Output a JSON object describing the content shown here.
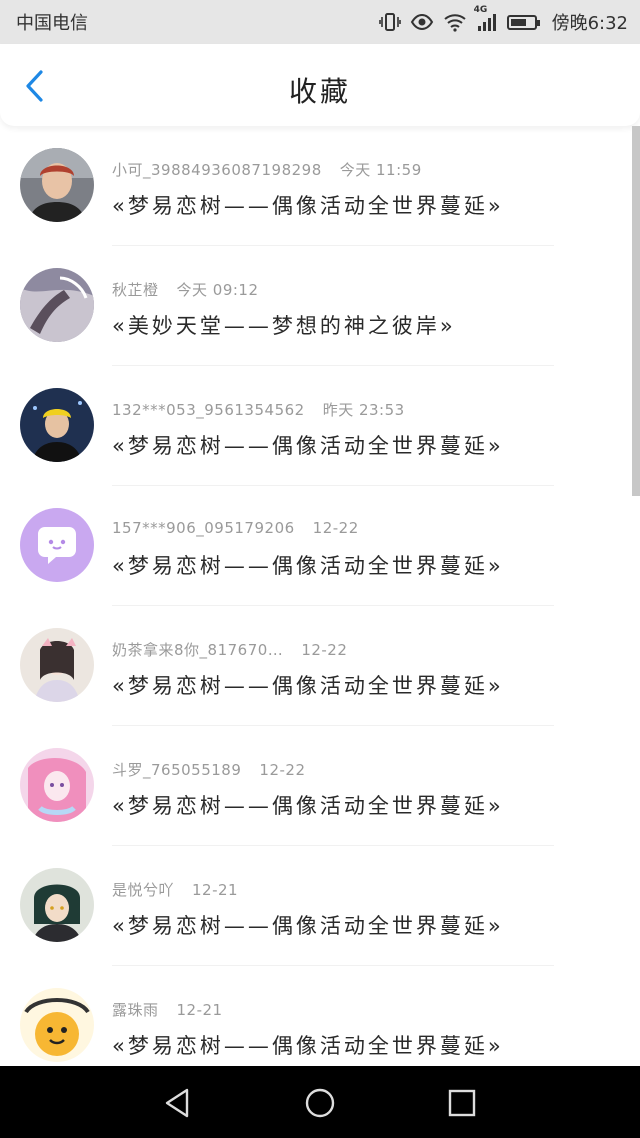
{
  "status_bar": {
    "carrier": "中国电信",
    "network": "4G",
    "time": "傍晚6:32"
  },
  "header": {
    "title": "收藏"
  },
  "items": [
    {
      "user": "小可_39884936087198298",
      "time": "今天 11:59",
      "content": "«梦易恋树——偶像活动全世界蔓延»"
    },
    {
      "user": "秋芷橙",
      "time": "今天 09:12",
      "content": "«美妙天堂——梦想的神之彼岸»"
    },
    {
      "user": "132***053_9561354562",
      "time": "昨天 23:53",
      "content": "«梦易恋树——偶像活动全世界蔓延»"
    },
    {
      "user": "157***906_095179206",
      "time": "12-22",
      "content": "«梦易恋树——偶像活动全世界蔓延»"
    },
    {
      "user": "奶茶拿来8你_817670…",
      "time": "12-22",
      "content": "«梦易恋树——偶像活动全世界蔓延»"
    },
    {
      "user": "斗罗_765055189",
      "time": "12-22",
      "content": "«梦易恋树——偶像活动全世界蔓延»"
    },
    {
      "user": "是悦兮吖",
      "time": "12-21",
      "content": "«梦易恋树——偶像活动全世界蔓延»"
    },
    {
      "user": "露珠雨",
      "time": "12-21",
      "content": "«梦易恋树——偶像活动全世界蔓延»"
    }
  ],
  "icons": {
    "back": "chevron-left-icon",
    "nav_back": "triangle-back-icon",
    "nav_home": "circle-home-icon",
    "nav_recent": "square-recent-icon"
  },
  "colors": {
    "accent": "#1e88e5",
    "meta_text": "#9a9a9a",
    "status_bar_bg": "#e6e6e6",
    "nav_bar_bg": "#000000"
  }
}
